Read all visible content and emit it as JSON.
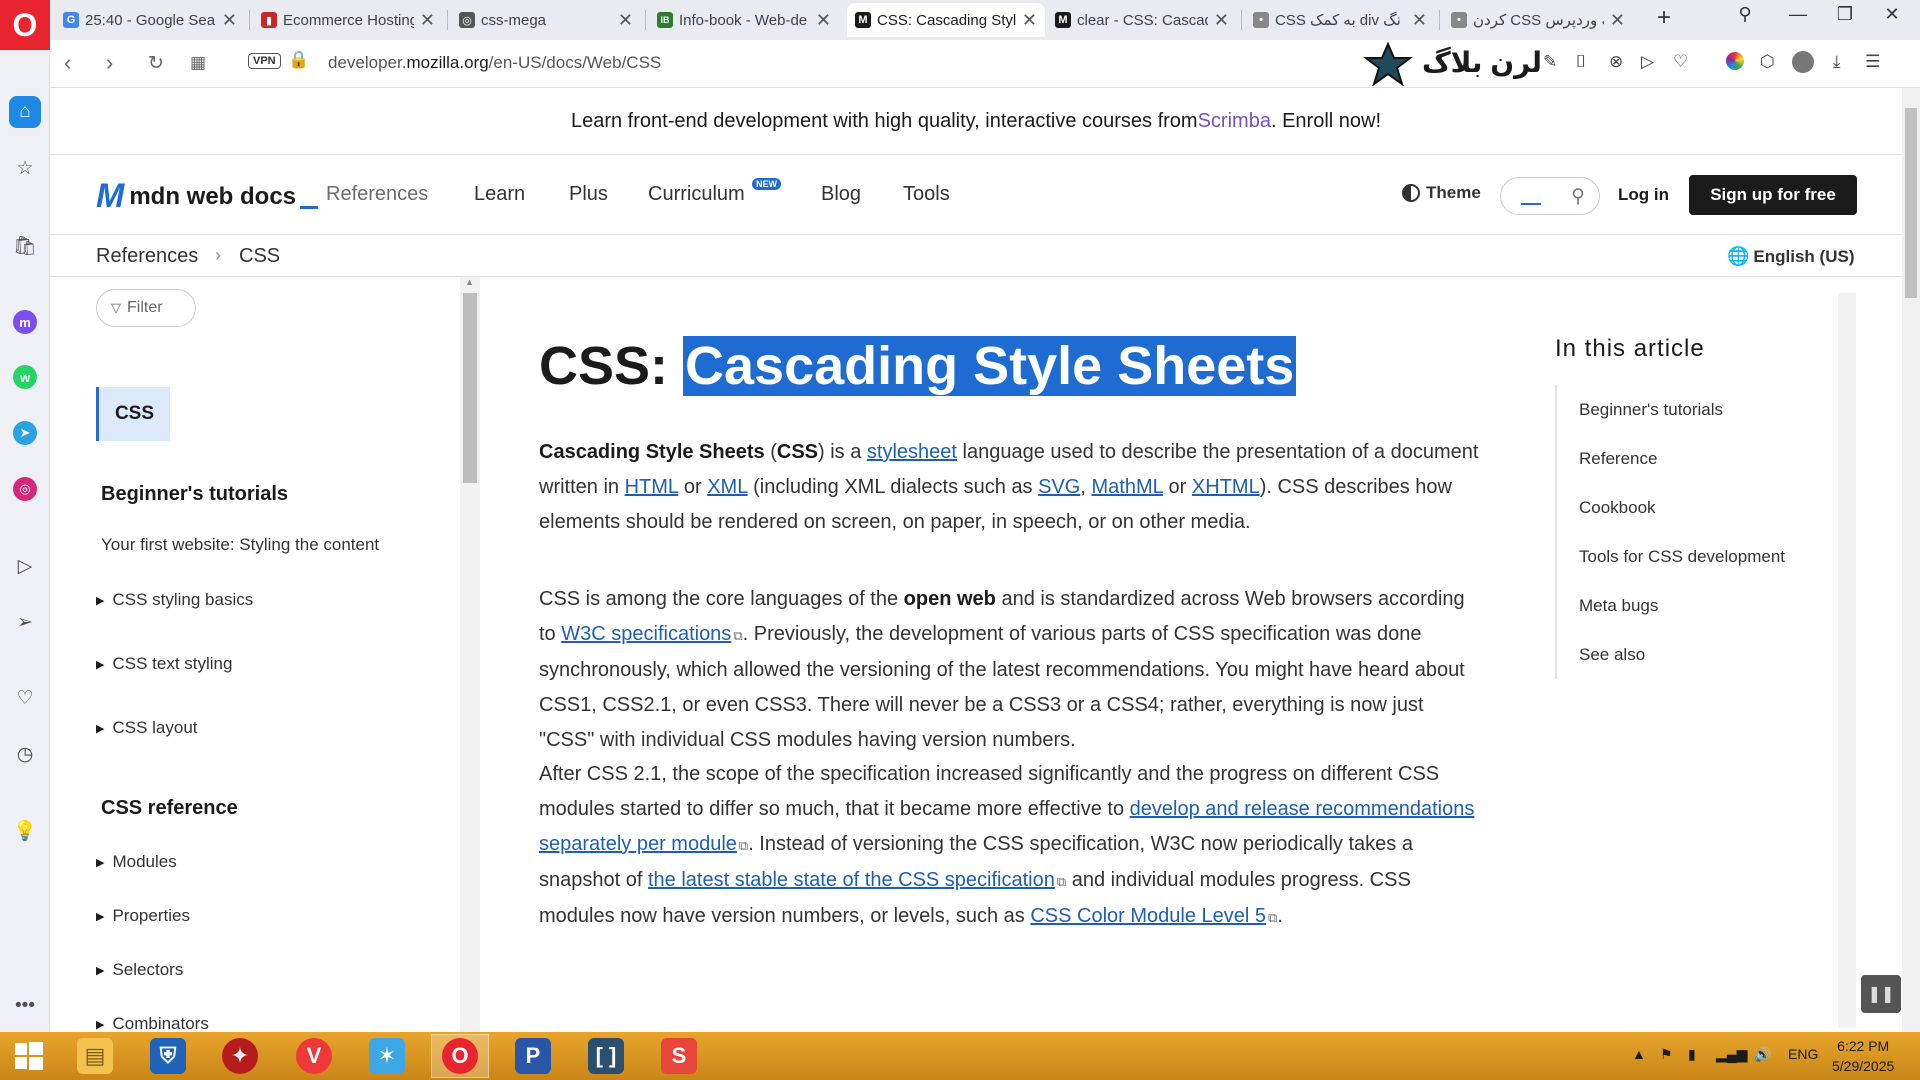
{
  "browser": {
    "tabs": [
      {
        "title": "25:40 - Google Sea",
        "fav": "G",
        "favcolor": "#4285f4"
      },
      {
        "title": "Ecommerce Hosting",
        "fav": "▮",
        "favcolor": "#c62828"
      },
      {
        "title": "css-mega",
        "fav": "◎",
        "favcolor": "#555555"
      },
      {
        "title": "Info-book - Web-de",
        "fav": "IB",
        "favcolor": "#2e7d32"
      },
      {
        "title": "CSS: Cascading Style",
        "fav": "M",
        "favcolor": "#1b1b1b"
      },
      {
        "title": "clear - CSS: Cascadi",
        "fav": "M",
        "favcolor": "#1b1b1b"
      },
      {
        "title": "CSS به کمک div نگ",
        "fav": "•",
        "favcolor": "#888888"
      },
      {
        "title": "کردن CSS به وردپرس",
        "fav": "•",
        "favcolor": "#888888"
      }
    ],
    "url_prefix": "developer.",
    "url_domain": "mozilla.org",
    "url_path": "/en-US/docs/Web/CSS",
    "vpn_label": "VPN",
    "brand_text": "لرن بلاگ"
  },
  "banner": {
    "text_before": "Learn front-end development with high quality, interactive courses from ",
    "link": "Scrimba",
    "text_after": ". Enroll now!"
  },
  "header": {
    "logo": "mdn web docs",
    "nav": [
      "References",
      "Learn",
      "Plus",
      "Curriculum",
      "Blog",
      "Tools"
    ],
    "new_badge": "NEW",
    "theme": "Theme",
    "login": "Log in",
    "signup": "Sign up for free"
  },
  "breadcrumb": {
    "items": [
      "References",
      "CSS"
    ],
    "language": "English (US)"
  },
  "sidebar": {
    "filter": "Filter",
    "current": "CSS",
    "sections": [
      {
        "title": "Beginner's tutorials",
        "items": [
          "Your first website: Styling the content"
        ],
        "toggles": [
          "CSS styling basics",
          "CSS text styling",
          "CSS layout"
        ]
      },
      {
        "title": "CSS reference",
        "toggles": [
          "Modules",
          "Properties",
          "Selectors",
          "Combinators"
        ]
      }
    ]
  },
  "article": {
    "title_prefix": "CSS: ",
    "title_highlight": "Cascading Style Sheets",
    "p1": {
      "b1": "Cascading Style Sheets",
      "t1": " (",
      "b2": "CSS",
      "t2": ") is a ",
      "l1": "stylesheet",
      "t3": " language used to describe the presentation of a document written in ",
      "l2": "HTML",
      "t4": " or ",
      "l3": "XML",
      "t5": " (including XML dialects such as ",
      "l4": "SVG",
      "t6": ", ",
      "l5": "MathML",
      "t7": " or ",
      "l6": "XHTML",
      "t8": "). CSS describes how elements should be rendered on screen, on paper, in speech, or on other media."
    },
    "p2": {
      "t1": "CSS is among the core languages of the ",
      "b1": "open web",
      "t2": " and is standardized across Web browsers according to ",
      "l1": "W3C specifications",
      "t3": ". Previously, the development of various parts of CSS specification was done synchronously, which allowed the versioning of the latest recommendations. You might have heard about CSS1, CSS2.1, or even CSS3. There will never be a CSS3 or a CSS4; rather, everything is now just \"CSS\" with individual CSS modules having version numbers."
    },
    "p3": {
      "t1": "After CSS 2.1, the scope of the specification increased significantly and the progress on different CSS modules started to differ so much, that it became more effective to ",
      "l1": "develop and release recommendations separately per module",
      "t2": ". Instead of versioning the CSS specification, W3C now periodically takes a snapshot of ",
      "l2": "the latest stable state of the CSS specification",
      "t3": " and individual modules progress. CSS modules now have version numbers, or levels, such as ",
      "l3": "CSS Color Module Level 5",
      "t4": "."
    }
  },
  "toc": {
    "title": "In this article",
    "items": [
      "Beginner's tutorials",
      "Reference",
      "Cookbook",
      "Tools for CSS development",
      "Meta bugs",
      "See also"
    ]
  },
  "taskbar": {
    "lang": "ENG",
    "time": "6:22 PM",
    "date": "5/29/2025"
  }
}
